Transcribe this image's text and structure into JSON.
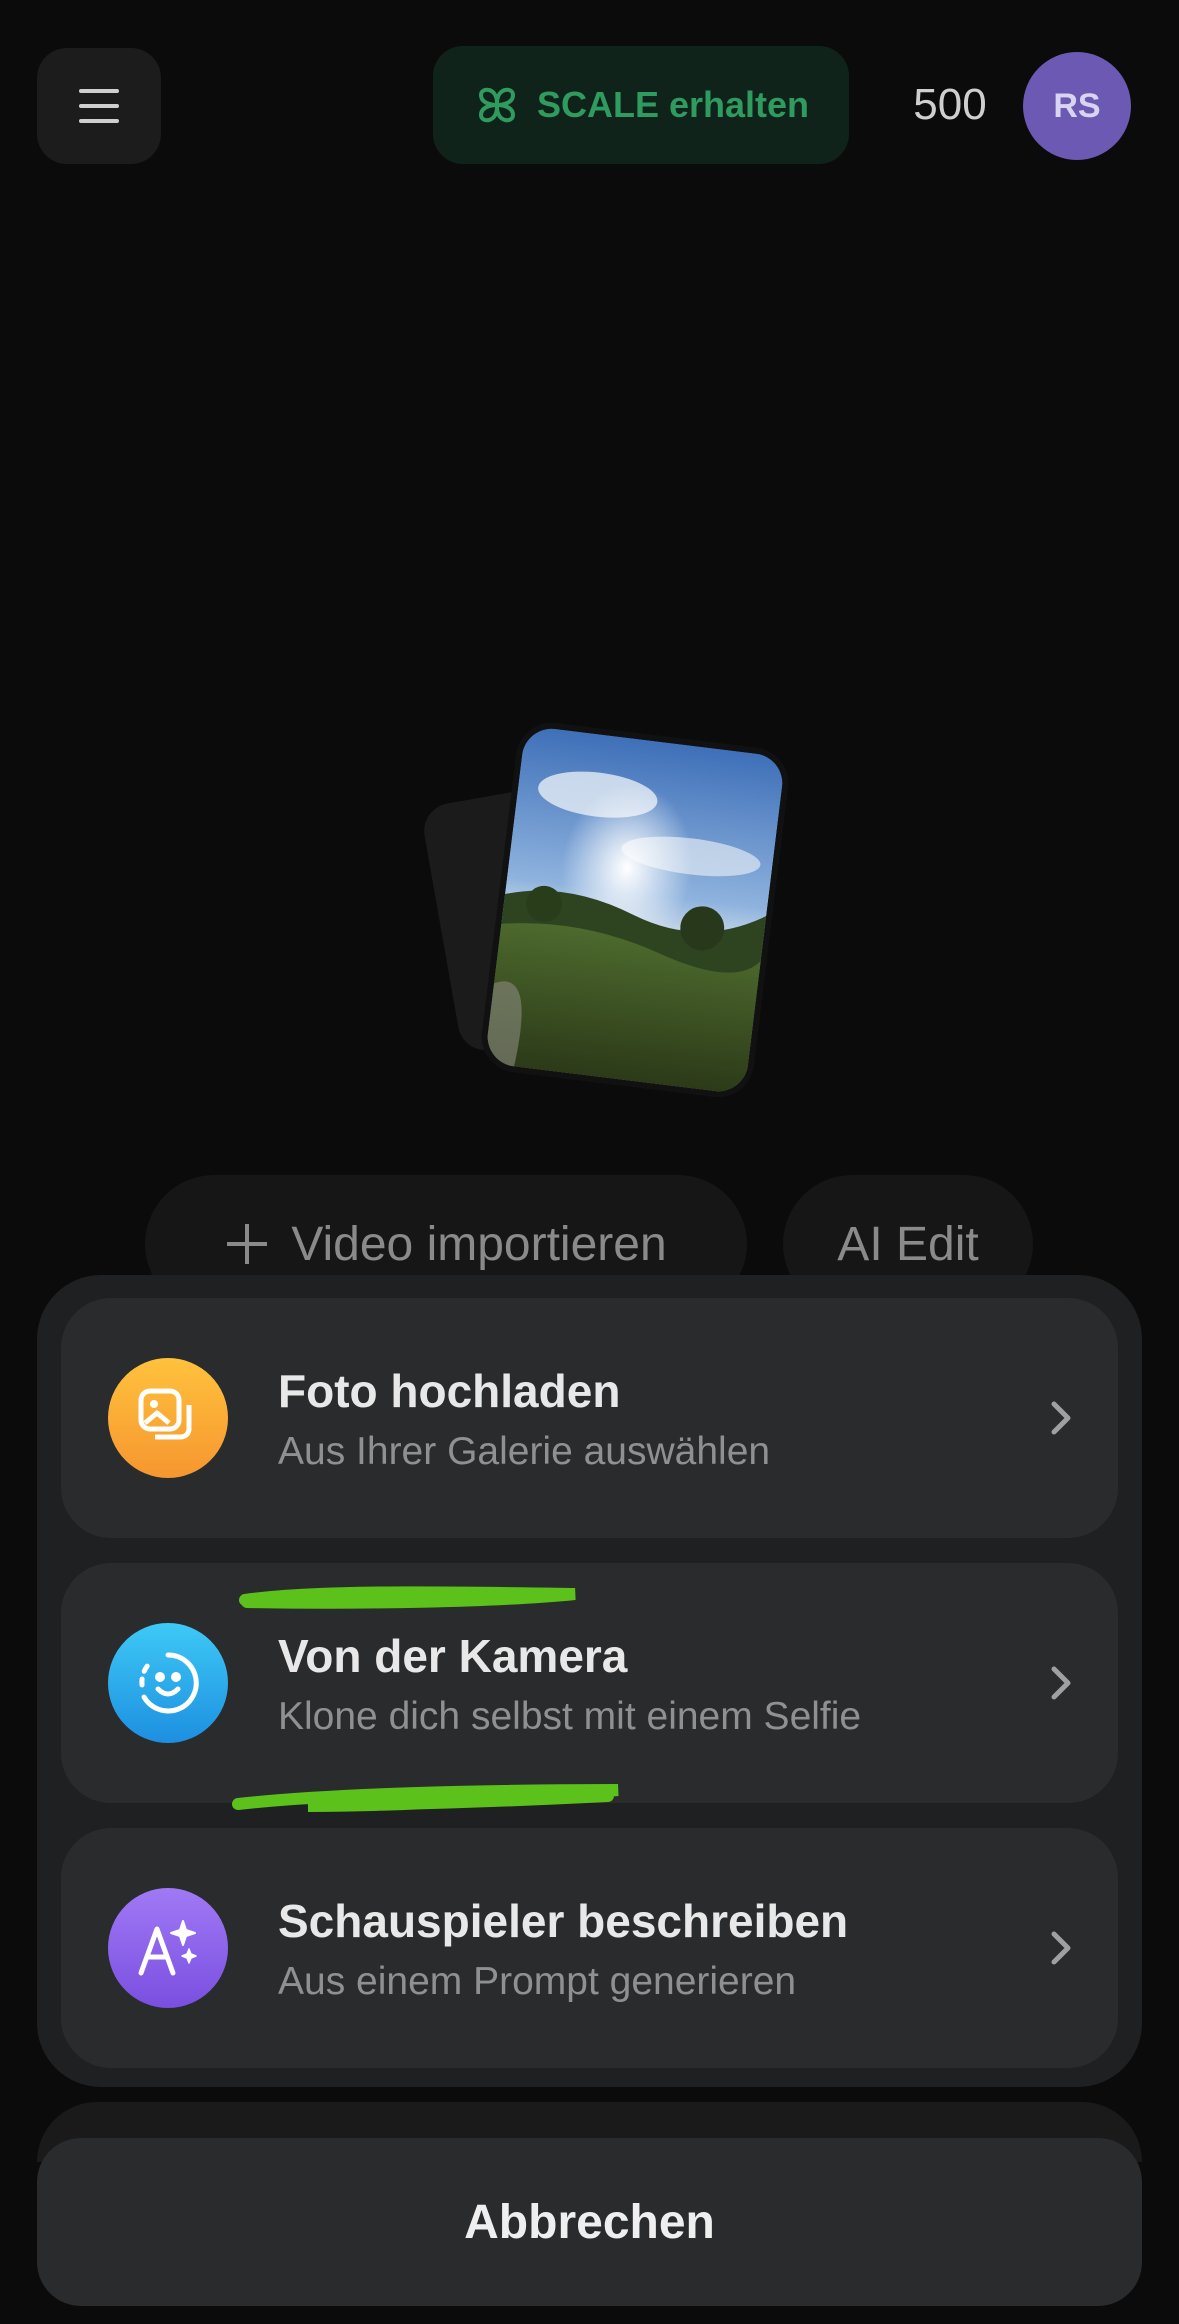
{
  "header": {
    "scale_button_label": "SCALE erhalten",
    "credits": "500",
    "avatar_initials": "RS"
  },
  "actions": {
    "import_video_label": "Video importieren",
    "ai_edit_label": "AI Edit"
  },
  "sheet": {
    "options": [
      {
        "title": "Foto hochladen",
        "subtitle": "Aus Ihrer Galerie auswählen",
        "icon": "gallery-icon",
        "color": "#f7a63a"
      },
      {
        "title": "Von der Kamera",
        "subtitle": "Klone dich selbst mit einem Selfie",
        "icon": "selfie-face-icon",
        "color": "#27a7e8"
      },
      {
        "title": "Schauspieler beschreiben",
        "subtitle": "Aus einem Prompt generieren",
        "icon": "ai-text-icon",
        "color": "#8a63e8"
      }
    ],
    "cancel_label": "Abbrechen"
  },
  "colors": {
    "background": "#0b0b0b",
    "sheet": "#1f2022",
    "option": "#2a2b2d",
    "scale_green": "#2f9b5e",
    "avatar": "#6c59b3",
    "highlight_scribble": "#5cc21b"
  }
}
